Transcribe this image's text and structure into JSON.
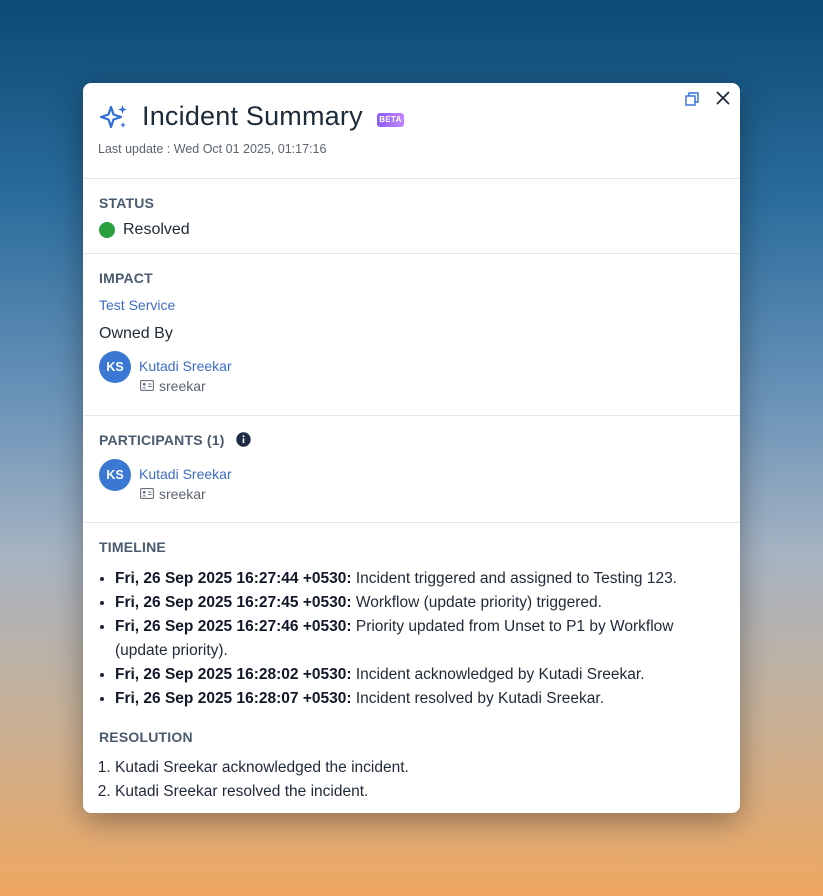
{
  "header": {
    "title": "Incident Summary",
    "badge": "BETA",
    "last_update": "Last update : Wed Oct 01 2025, 01:17:16"
  },
  "status": {
    "label": "STATUS",
    "value": "Resolved",
    "color": "#29a03d"
  },
  "impact": {
    "label": "IMPACT",
    "service": "Test Service",
    "owned_by_label": "Owned By",
    "owner": {
      "initials": "KS",
      "name": "Kutadi Sreekar",
      "handle": "sreekar"
    }
  },
  "participants": {
    "label": "PARTICIPANTS (1)",
    "items": [
      {
        "initials": "KS",
        "name": "Kutadi Sreekar",
        "handle": "sreekar"
      }
    ]
  },
  "timeline": {
    "label": "TIMELINE",
    "events": [
      {
        "time": "Fri, 26 Sep 2025 16:27:44 +0530:",
        "text": "Incident triggered and assigned to Testing 123."
      },
      {
        "time": "Fri, 26 Sep 2025 16:27:45 +0530:",
        "text": "Workflow (update priority) triggered."
      },
      {
        "time": "Fri, 26 Sep 2025 16:27:46 +0530:",
        "text": "Priority updated from Unset to P1 by Workflow (update priority)."
      },
      {
        "time": "Fri, 26 Sep 2025 16:28:02 +0530:",
        "text": "Incident acknowledged by Kutadi Sreekar."
      },
      {
        "time": "Fri, 26 Sep 2025 16:28:07 +0530:",
        "text": "Incident resolved by Kutadi Sreekar."
      }
    ]
  },
  "resolution": {
    "label": "RESOLUTION",
    "steps": [
      "Kutadi Sreekar acknowledged the incident.",
      "Kutadi Sreekar resolved the incident."
    ]
  },
  "colors": {
    "link": "#3d6cc4",
    "avatar": "#3a78d4",
    "beta_gradient": [
      "#8b5cf6",
      "#c084fc"
    ]
  },
  "icons": {
    "title": "sparkle-icon",
    "copy": "copy-icon",
    "close": "close-icon",
    "info": "info-icon",
    "handle": "id-card-icon"
  }
}
